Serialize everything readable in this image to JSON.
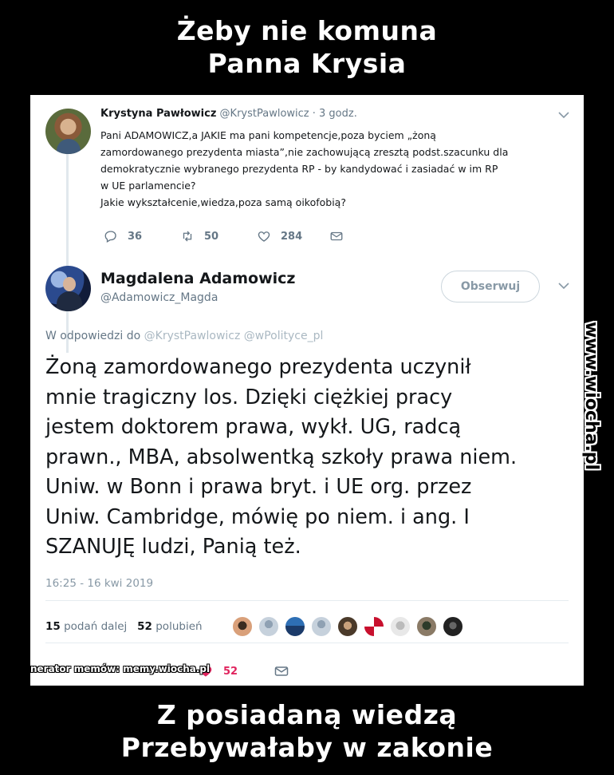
{
  "meme": {
    "top_line1": "Żeby nie komuna",
    "top_line2": "Panna Krysia",
    "bottom_line1": "Z posiadaną wiedzą",
    "bottom_line2": "Przebywałaby w zakonie",
    "site_vertical": "www.wiocha.pl",
    "generator_label": "Generator memów: memy.wiocha.pl"
  },
  "reply_tweet": {
    "author_name": "Krystyna Pawłowicz",
    "author_handle": "@KrystPawlowicz",
    "time": "· 3 godz.",
    "text_lines": [
      "Pani ADAMOWICZ,a JAKIE ma pani kompetencje,poza byciem „żoną",
      "zamordowanego prezydenta miasta”,nie zachowującą zresztą podst.szacunku dla",
      "demokratycznie wybranego prezydenta RP - by kandydować i zasiadać w im RP",
      "w UE parlamencie?",
      "Jakie wykształcenie,wiedza,poza samą oikofobią?"
    ],
    "replies": "36",
    "retweets": "50",
    "likes": "284"
  },
  "main_tweet": {
    "author_name": "Magdalena Adamowicz",
    "author_handle": "@Adamowicz_Magda",
    "follow_label": "Obserwuj",
    "reply_prefix": "W odpowiedzi do",
    "reply_mentions": "@KrystPawlowicz @wPolityce_pl",
    "text_lines": [
      "Żoną zamordowanego prezydenta uczynił",
      "mnie tragiczny los. Dzięki ciężkiej pracy",
      "jestem doktorem prawa, wykł. UG, radcą",
      "prawn., MBA, absolwentką szkoły prawa niem.",
      "Uniw. w Bonn i prawa bryt. i UE org. przez",
      "Uniw. Cambridge, mówię po niem. i ang.  I",
      "SZANUJĘ ludzi, Panią też."
    ],
    "timestamp": "16:25 - 16 kwi 2019",
    "retweets_count": "15",
    "retweets_label": "podań dalej",
    "likes_count": "52",
    "likes_label": "polubień",
    "heart_count": "52"
  },
  "colors": {
    "heart": "#e0245e",
    "mention": "#aab8c2",
    "muted": "#657786"
  }
}
